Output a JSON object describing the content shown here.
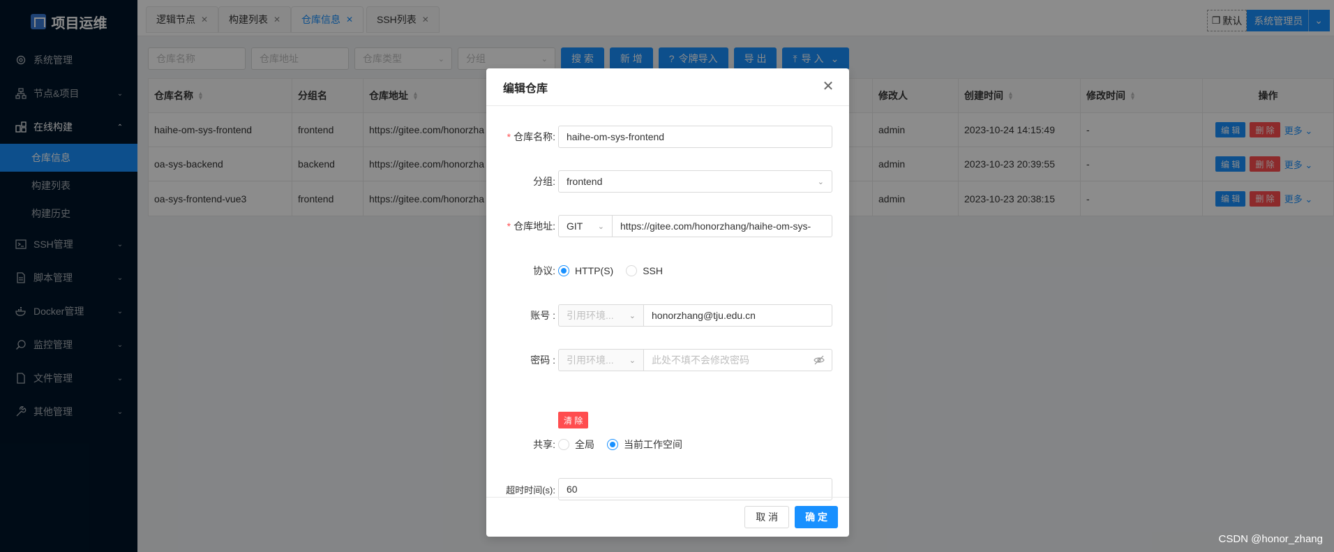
{
  "app": {
    "title": "项目运维"
  },
  "colors": {
    "accent": "#1890ff",
    "danger": "#ff4d4f",
    "sidebar": "#001529"
  },
  "sidebar": {
    "items": [
      {
        "label": "系统管理",
        "icon": "gear-icon",
        "chev": ""
      },
      {
        "label": "节点&项目",
        "icon": "nodes-icon",
        "chev": "⌄"
      },
      {
        "label": "在线构建",
        "icon": "build-icon",
        "chev": "⌃"
      },
      {
        "label": "SSH管理",
        "icon": "terminal-icon",
        "chev": "⌄"
      },
      {
        "label": "脚本管理",
        "icon": "script-icon",
        "chev": "⌄"
      },
      {
        "label": "Docker管理",
        "icon": "docker-icon",
        "chev": "⌄"
      },
      {
        "label": "监控管理",
        "icon": "monitor-icon",
        "chev": "⌄"
      },
      {
        "label": "文件管理",
        "icon": "file-icon",
        "chev": "⌄"
      },
      {
        "label": "其他管理",
        "icon": "tools-icon",
        "chev": "⌄"
      }
    ],
    "sub_items": [
      "仓库信息",
      "构建列表",
      "构建历史"
    ]
  },
  "tabs": [
    "逻辑节点",
    "构建列表",
    "仓库信息",
    "SSH列表"
  ],
  "header": {
    "workspace": "默认",
    "user": "系统管理员"
  },
  "filters": {
    "placeholders": [
      "仓库名称",
      "仓库地址",
      "仓库类型",
      "分组"
    ],
    "buttons": [
      "搜 索",
      "新 增",
      "令牌导入",
      "导 出",
      "导 入"
    ]
  },
  "table": {
    "columns": [
      "仓库名称",
      "分组名",
      "仓库地址",
      "修改人",
      "创建时间",
      "修改时间",
      "操作"
    ],
    "rows": [
      [
        "haihe-om-sys-frontend",
        "frontend",
        "https://gitee.com/honorzha",
        "admin",
        "2023-10-24 14:15:49",
        "-"
      ],
      [
        "oa-sys-backend",
        "backend",
        "https://gitee.com/honorzha",
        "admin",
        "2023-10-23 20:39:55",
        "-"
      ],
      [
        "oa-sys-frontend-vue3",
        "frontend",
        "https://gitee.com/honorzha",
        "admin",
        "2023-10-23 20:38:15",
        "-"
      ]
    ],
    "ops": {
      "edit": "编 辑",
      "delete": "删 除",
      "more": "更多"
    }
  },
  "modal": {
    "title": "编辑仓库",
    "fields": {
      "name": {
        "label": "仓库名称:",
        "value": "haihe-om-sys-frontend"
      },
      "group": {
        "label": "分组:",
        "value": "frontend"
      },
      "url": {
        "label": "仓库地址:",
        "type": "GIT",
        "value": "https://gitee.com/honorzhang/haihe-om-sys-"
      },
      "protocol": {
        "label": "协议:",
        "options": [
          "HTTP(S)",
          "SSH"
        ],
        "selected": "HTTP(S)"
      },
      "account": {
        "label": "账号 :",
        "env_placeholder": "引用环境...",
        "value": "honorzhang@tju.edu.cn"
      },
      "password": {
        "label": "密码 :",
        "env_placeholder": "引用环境...",
        "placeholder": "此处不填不会修改密码",
        "clear": "清 除"
      },
      "share": {
        "label": "共享:",
        "options": [
          "全局",
          "当前工作空间"
        ],
        "selected": "当前工作空间"
      },
      "timeout": {
        "label": "超时时间(s):",
        "value": "60"
      }
    },
    "cancel": "取 消",
    "ok": "确 定"
  },
  "watermark": "CSDN @honor_zhang"
}
